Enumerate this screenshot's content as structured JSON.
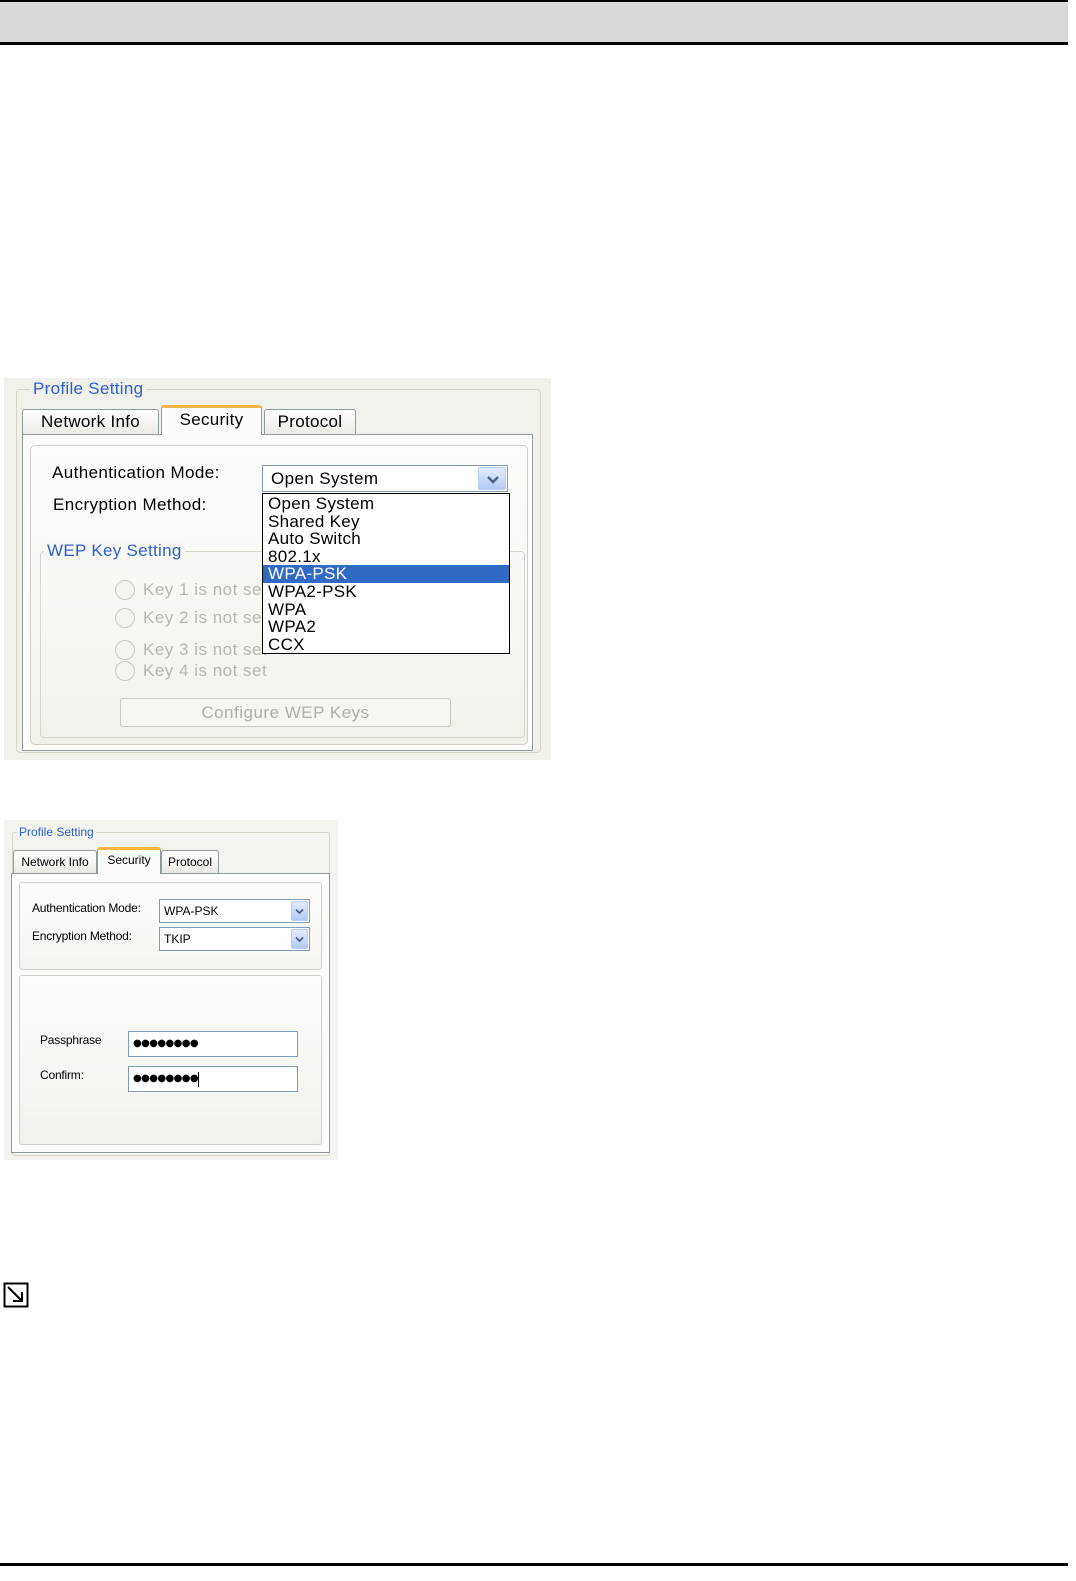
{
  "colors": {
    "title_blue": "#2d5fcf",
    "selection": "#316ac5",
    "tab_highlight": "#f5b54a",
    "disabled_text": "#b7b7b0"
  },
  "icons": {
    "combo_arrow": "chevron-down-icon",
    "note": "note-icon"
  },
  "profile_setting_1": {
    "group_title": "Profile Setting",
    "tabs": [
      "Network Info",
      "Security",
      "Protocol"
    ],
    "auth_label": "Authentication Mode:",
    "auth_value": "Open System",
    "enc_label": "Encryption Method:",
    "auth_options": [
      "Open System",
      "Shared Key",
      "Auto Switch",
      "802.1x",
      "WPA-PSK",
      "WPA2-PSK",
      "WPA",
      "WPA2",
      "CCX"
    ],
    "highlighted_option_index": 4,
    "wep_group_title": "WEP Key Setting",
    "wep_keys": [
      "Key 1 is not set",
      "Key 2 is not set",
      "Key 3 is not set",
      "Key 4 is not set"
    ],
    "configure_button": "Configure WEP Keys"
  },
  "profile_setting_2": {
    "group_title": "Profile Setting",
    "tabs": [
      "Network Info",
      "Security",
      "Protocol"
    ],
    "auth_label": "Authentication Mode:",
    "auth_value": "WPA-PSK",
    "enc_label": "Encryption Method:",
    "enc_value": "TKIP",
    "passphrase_label": "Passphrase",
    "passphrase_value": "●●●●●●●●",
    "confirm_label": "Confirm:",
    "confirm_value": "●●●●●●●●"
  }
}
